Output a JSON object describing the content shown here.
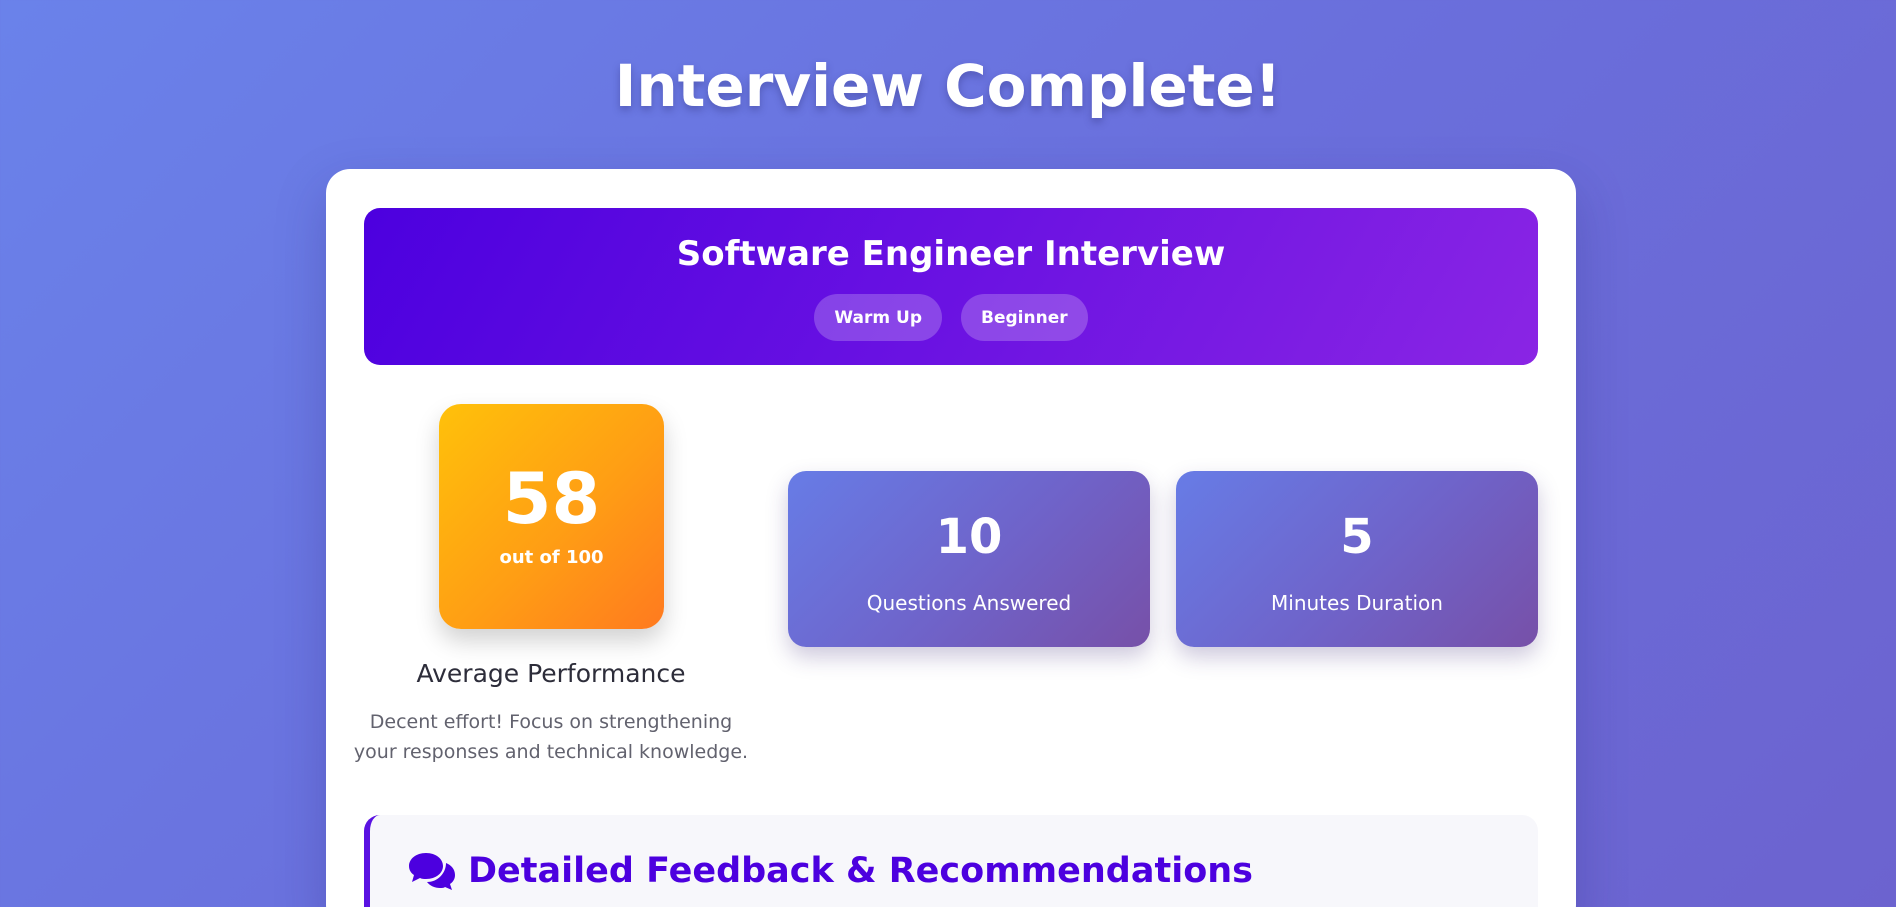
{
  "page": {
    "title": "Interview Complete!"
  },
  "interview": {
    "title": "Software Engineer Interview",
    "tags": [
      "Warm Up",
      "Beginner"
    ]
  },
  "score": {
    "value": "58",
    "subtitle": "out of 100",
    "rating": "Average Performance",
    "description": "Decent effort! Focus on strengthening your responses and technical knowledge."
  },
  "stats": [
    {
      "value": "10",
      "label": "Questions Answered"
    },
    {
      "value": "5",
      "label": "Minutes Duration"
    }
  ],
  "feedback": {
    "title": "Detailed Feedback & Recommendations",
    "icon": "comments-icon"
  },
  "colors": {
    "background": "#6a74e0",
    "banner_start": "#4c00df",
    "banner_end": "#8a25e4",
    "score_start": "#ffc10a",
    "score_end": "#ff7a1f",
    "stat_start": "#677ce6",
    "stat_end": "#7750a8",
    "feedback_accent": "#4c00df"
  }
}
